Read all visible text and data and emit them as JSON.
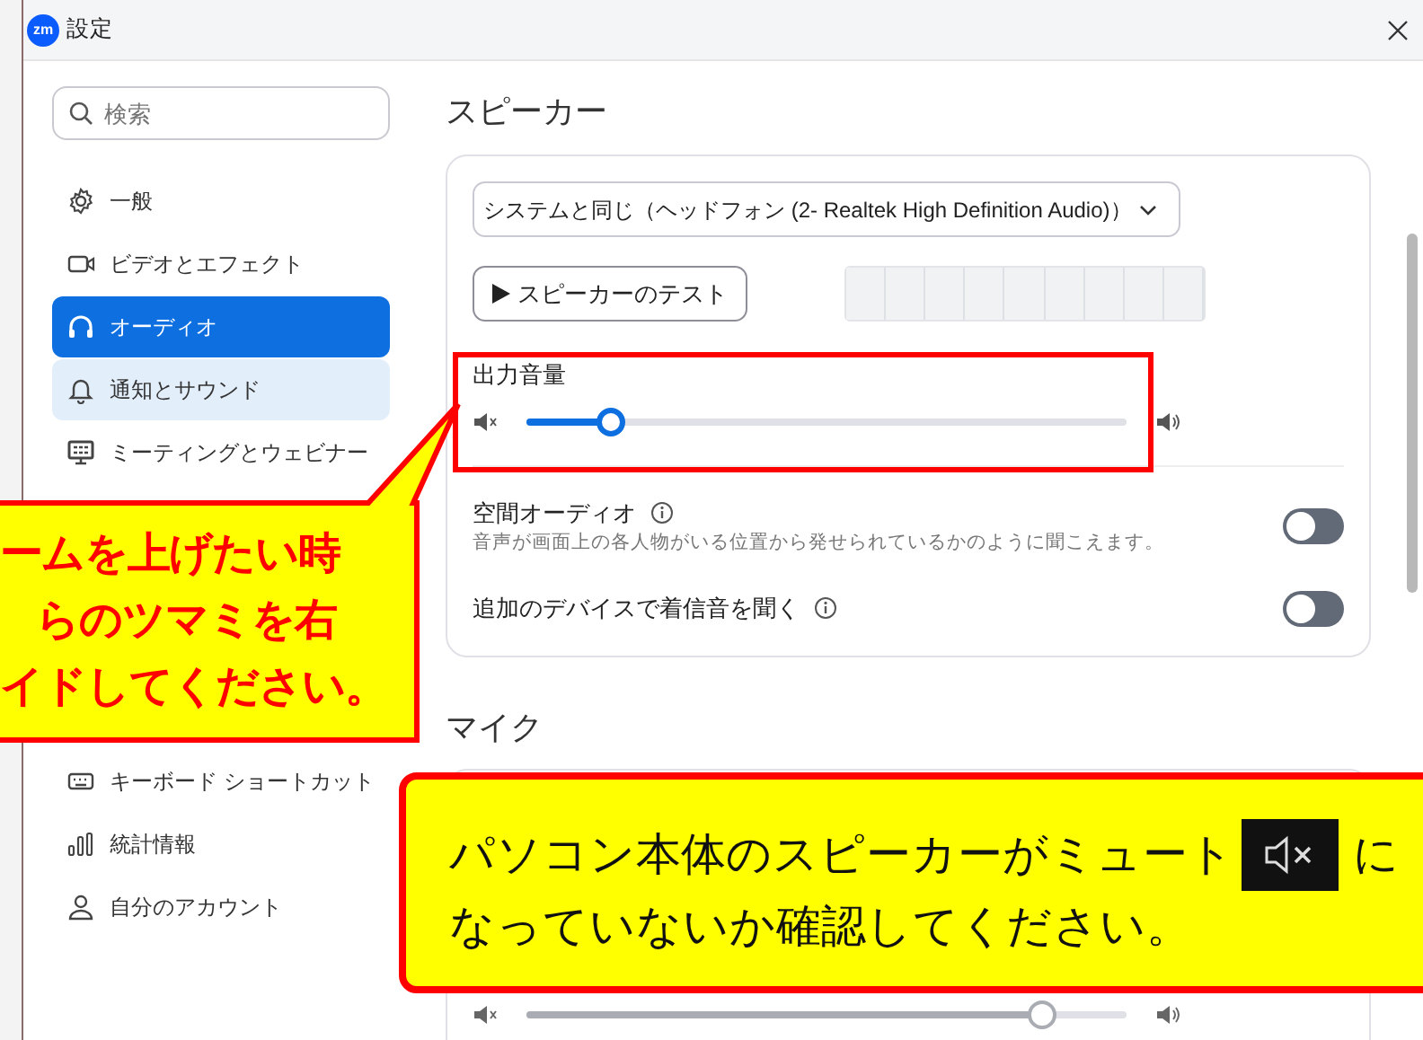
{
  "window": {
    "logo": "zm",
    "title": "設定"
  },
  "sidebar": {
    "search": {
      "placeholder": "検索"
    },
    "items": [
      {
        "label": "一般",
        "kind": "gear",
        "selected": false,
        "hovered": false
      },
      {
        "label": "ビデオとエフェクト",
        "kind": "camera",
        "selected": false,
        "hovered": false
      },
      {
        "label": "オーディオ",
        "kind": "headphones",
        "selected": true,
        "hovered": false
      },
      {
        "label": "通知とサウンド",
        "kind": "bell",
        "selected": false,
        "hovered": true
      },
      {
        "label": "ミーティングとウェビナー",
        "kind": "monitor",
        "selected": false,
        "hovered": false
      }
    ],
    "lower_items": [
      {
        "label": "キーボード ショートカット",
        "kind": "keyboard",
        "selected": false,
        "hovered": false
      },
      {
        "label": "統計情報",
        "kind": "chart",
        "selected": false,
        "hovered": false
      },
      {
        "label": "自分のアカウント",
        "kind": "person",
        "selected": false,
        "hovered": false
      }
    ]
  },
  "speaker": {
    "heading": "スピーカー",
    "device": "システムと同じ（ヘッドフォン (2- Realtek High Definition Audio)）",
    "test_button": "スピーカーのテスト",
    "meter": {
      "level": 0
    },
    "volume_label": "出力音量",
    "volume": {
      "level": 0.14
    },
    "options": [
      {
        "label": "空間オーディオ",
        "description": "音声が画面上の各人物がいる位置から発せられているかのように聞こえます。",
        "on": false
      },
      {
        "label": "追加のデバイスで着信音を聞く",
        "on": false
      }
    ]
  },
  "microphone": {
    "heading": "マイク",
    "volume": {
      "level": 0.86
    }
  },
  "callouts": [
    {
      "kind": "left",
      "lines": [
        "ームを上げたい時",
        "らのツマミを右",
        "イドしてください。"
      ]
    },
    {
      "kind": "bottom",
      "line1_before": "パソコン本体のスピーカーがミュート",
      "line1_after": "に",
      "line2": "なっていないか確認してください。"
    }
  ]
}
